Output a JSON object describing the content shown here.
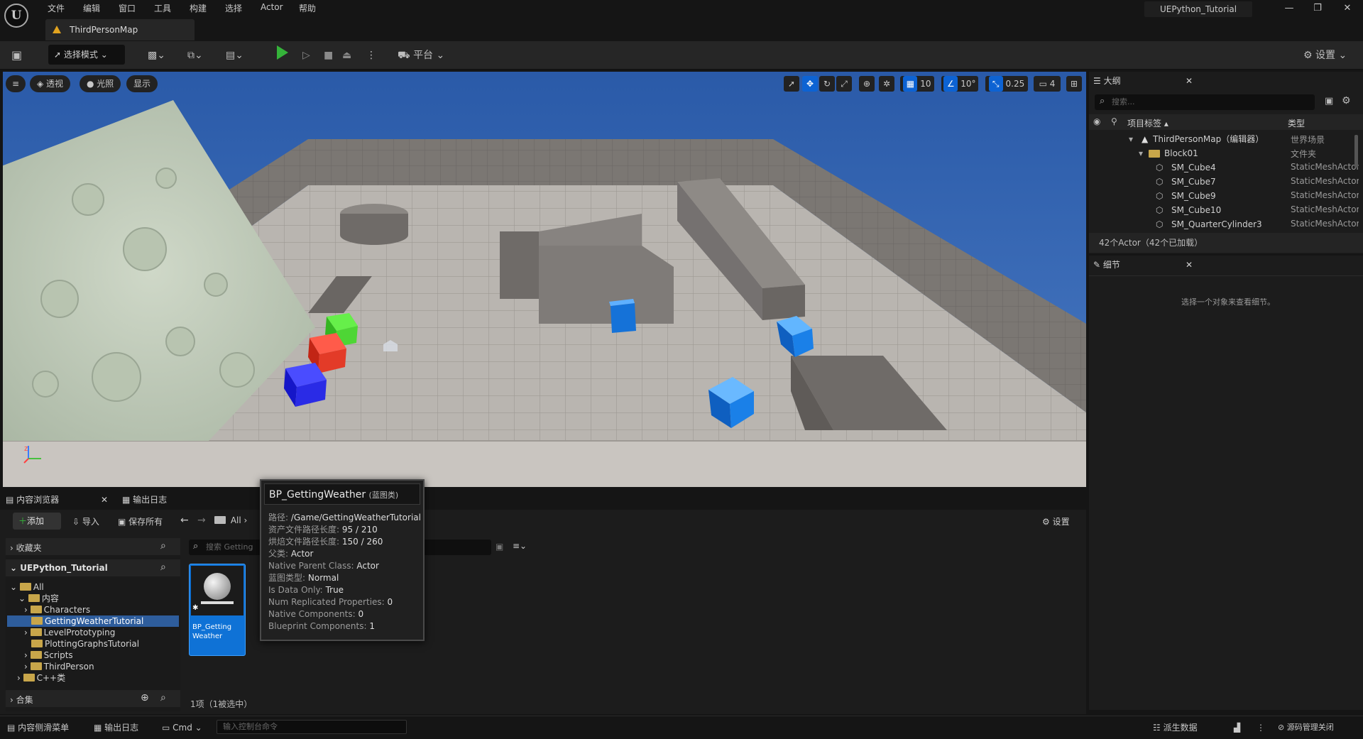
{
  "titlebar": {
    "menu": [
      "文件",
      "编辑",
      "窗口",
      "工具",
      "构建",
      "选择",
      "Actor",
      "帮助"
    ],
    "project": "UEPython_Tutorial",
    "min": "—",
    "max": "❐",
    "close": "✕"
  },
  "tab": {
    "map": "ThirdPersonMap"
  },
  "toolbar": {
    "mode": "选择模式",
    "platform": "平台",
    "settings": "设置"
  },
  "viewport": {
    "perspective": "透视",
    "lighting": "光照",
    "show": "显示",
    "grid": "10",
    "angle": "10°",
    "scale": "0.25",
    "camera_speed": "4"
  },
  "outliner": {
    "tab": "大纲",
    "search_placeholder": "搜索...",
    "col_label": "项目标签 ▴",
    "col_type": "类型",
    "rows": [
      {
        "label": "ThirdPersonMap（编辑器）",
        "type": "世界场景"
      },
      {
        "label": "Block01",
        "type": "文件夹"
      },
      {
        "label": "SM_Cube4",
        "type": "StaticMeshActor"
      },
      {
        "label": "SM_Cube7",
        "type": "StaticMeshActor"
      },
      {
        "label": "SM_Cube9",
        "type": "StaticMeshActor"
      },
      {
        "label": "SM_Cube10",
        "type": "StaticMeshActor"
      },
      {
        "label": "SM_QuarterCylinder3",
        "type": "StaticMeshActor"
      }
    ],
    "count": "42个Actor（42个已加载）"
  },
  "details": {
    "tab": "细节",
    "empty": "选择一个对象来查看细节。"
  },
  "content_browser": {
    "tab1": "内容浏览器",
    "tab2": "输出日志",
    "add": "添加",
    "import": "导入",
    "save_all": "保存所有",
    "path": "All",
    "settings": "设置",
    "favorites": "收藏夹",
    "project": "UEPython_Tutorial",
    "tree": {
      "all": "All",
      "content": "内容",
      "characters": "Characters",
      "getting_weather": "GettingWeatherTutorial",
      "level_proto": "LevelPrototyping",
      "plotting": "PlottingGraphsTutorial",
      "scripts": "Scripts",
      "third_person": "ThirdPerson",
      "cpp": "C++类"
    },
    "collections": "合集",
    "search_placeholder": "搜索 Getting",
    "asset_name": "BP_Getting Weather",
    "selection": "1项（1被选中）"
  },
  "tooltip": {
    "title": "BP_GettingWeather",
    "title_suffix": "(蓝图类)",
    "path_label": "路径:",
    "path": "/Game/GettingWeatherTutorial",
    "asset_len_label": "资产文件路径长度:",
    "asset_len": "95 / 210",
    "cook_len_label": "烘焙文件路径长度:",
    "cook_len": "150 / 260",
    "parent_label": "父类:",
    "parent": "Actor",
    "native_parent_label": "Native Parent Class:",
    "native_parent": "Actor",
    "bp_type_label": "蓝图类型:",
    "bp_type": "Normal",
    "data_only_label": "Is Data Only:",
    "data_only": "True",
    "replicated_label": "Num Replicated Properties:",
    "replicated": "0",
    "native_comp_label": "Native Components:",
    "native_comp": "0",
    "bp_comp_label": "Blueprint Components:",
    "bp_comp": "1"
  },
  "statusbar": {
    "drawer": "内容侧滑菜单",
    "output": "输出日志",
    "cmd": "Cmd",
    "console_placeholder": "输入控制台命令",
    "derived": "派生数据",
    "source": "源码管理关闭"
  },
  "colors": {
    "accent": "#0d63d3",
    "play": "#35b33a",
    "panel": "#1c1c1c",
    "sky": "#2f63b3"
  }
}
